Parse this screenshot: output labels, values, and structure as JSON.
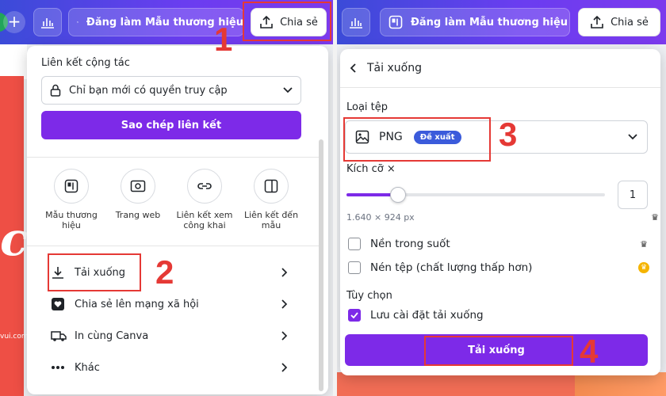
{
  "left": {
    "toolbar": {
      "brand_button_label": "Đăng làm Mẫu thương hiệu",
      "share_button_label": "Chia sẻ"
    },
    "canvas": {
      "big_letter": "c",
      "url_fragment": "vui.com"
    },
    "share_panel": {
      "collab_title": "Liên kết cộng tác",
      "access_select_value": "Chỉ bạn mới có quyền truy cập",
      "copy_link_button": "Sao chép liên kết",
      "options": [
        {
          "label": "Mẫu thương hiệu",
          "icon": "brand-template-icon"
        },
        {
          "label": "Trang web",
          "icon": "website-icon"
        },
        {
          "label": "Liên kết xem công khai",
          "icon": "link-icon"
        },
        {
          "label": "Liên kết đến mẫu",
          "icon": "template-link-icon"
        }
      ],
      "menu": [
        {
          "label": "Tải xuống",
          "icon": "download-icon"
        },
        {
          "label": "Chia sẻ lên mạng xã hội",
          "icon": "heart-icon"
        },
        {
          "label": "In cùng Canva",
          "icon": "truck-icon"
        },
        {
          "label": "Khác",
          "icon": "more-dots-icon"
        }
      ]
    }
  },
  "right": {
    "toolbar": {
      "brand_button_label": "Đăng làm Mẫu thương hiệu",
      "share_button_label": "Chia sẻ"
    },
    "download_panel": {
      "title": "Tải xuống",
      "file_type_label": "Loại tệp",
      "file_type_value": "PNG",
      "recommended_badge": "Đề xuất",
      "size_label": "Kích cỡ ×",
      "size_value": "1",
      "size_slider_fraction": 0.2,
      "dimensions": "1.640 × 924 px",
      "transparent_bg_label": "Nền trong suốt",
      "compress_label": "Nén tệp (chất lượng thấp hơn)",
      "options_label": "Tùy chọn",
      "save_settings_label": "Lưu cài đặt tải xuống",
      "save_settings_checked": true,
      "download_button": "Tải xuống"
    }
  },
  "annotations": [
    "1",
    "2",
    "3",
    "4"
  ],
  "colors": {
    "accent": "#7d2ae8",
    "annotation": "#e53935",
    "badge": "#3b5bdb"
  }
}
